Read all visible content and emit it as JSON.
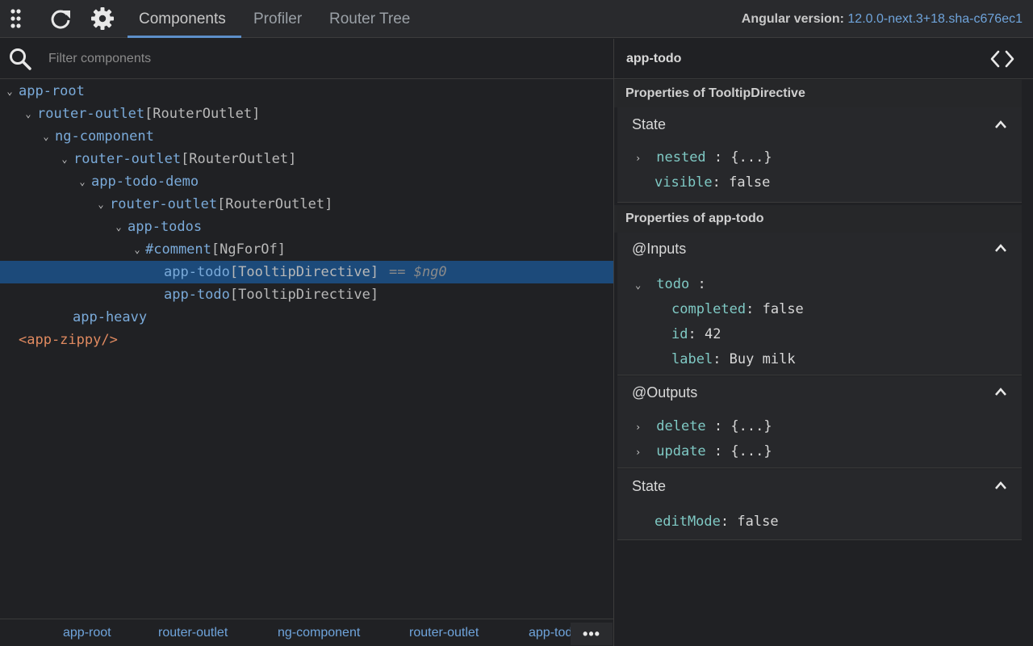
{
  "topbar": {
    "tabs": [
      {
        "label": "Components",
        "active": true
      },
      {
        "label": "Profiler",
        "active": false
      },
      {
        "label": "Router Tree",
        "active": false
      }
    ],
    "version_label": "Angular version:",
    "version_value": "12.0.0-next.3+18.sha-c676ec1",
    "icons": [
      "apps-grid-icon",
      "refresh-icon",
      "gear-icon"
    ]
  },
  "filter": {
    "placeholder": "Filter components"
  },
  "tree": [
    {
      "name": "app-root",
      "directive": "",
      "expanded": true
    },
    {
      "name": "router-outlet",
      "directive": "[RouterOutlet]",
      "expanded": true
    },
    {
      "name": "ng-component",
      "directive": "",
      "expanded": true
    },
    {
      "name": "router-outlet",
      "directive": "[RouterOutlet]",
      "expanded": true
    },
    {
      "name": "app-todo-demo",
      "directive": "",
      "expanded": true
    },
    {
      "name": "router-outlet",
      "directive": "[RouterOutlet]",
      "expanded": true
    },
    {
      "name": "app-todos",
      "directive": "",
      "expanded": true
    },
    {
      "name": "#comment",
      "directive": "[NgForOf]",
      "expanded": true
    },
    {
      "name": "app-todo",
      "directive": "[TooltipDirective]",
      "ref": "== $ng0",
      "selected": true
    },
    {
      "name": "app-todo",
      "directive": "[TooltipDirective]"
    },
    {
      "name": "app-heavy",
      "directive": ""
    },
    {
      "name": "<app-zippy/>",
      "directive": ""
    }
  ],
  "breadcrumbs": [
    "app-root",
    "router-outlet",
    "ng-component",
    "router-outlet",
    "app-todo"
  ],
  "more_label": "•••",
  "details": {
    "title": "app-todo",
    "sections": [
      {
        "title": "Properties of TooltipDirective",
        "panels": [
          {
            "title": "State",
            "props": [
              {
                "key": "nested",
                "value": "{...}"
              },
              {
                "key": "visible",
                "value": "false"
              }
            ]
          }
        ]
      },
      {
        "title": "Properties of app-todo",
        "panels": [
          {
            "title": "@Inputs",
            "props": [
              {
                "key": "todo",
                "value": ""
              },
              {
                "key": "completed",
                "value": "false"
              },
              {
                "key": "id",
                "value": "42"
              },
              {
                "key": "label",
                "value": "Buy milk"
              }
            ]
          },
          {
            "title": "@Outputs",
            "props": [
              {
                "key": "delete",
                "value": "{...}"
              },
              {
                "key": "update",
                "value": "{...}"
              }
            ]
          },
          {
            "title": "State",
            "props": [
              {
                "key": "editMode",
                "value": "false"
              }
            ]
          }
        ]
      }
    ]
  }
}
